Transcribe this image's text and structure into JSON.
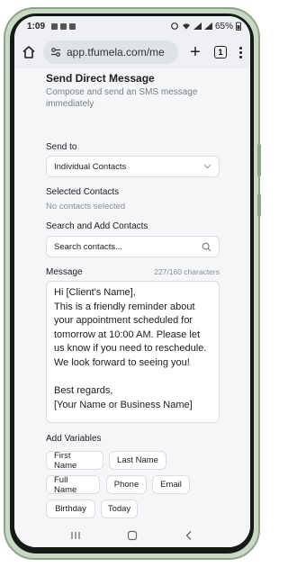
{
  "status_bar": {
    "time": "1:09",
    "battery": "65%"
  },
  "browser": {
    "url": "app.tfumela.com/me",
    "tab_count": "1"
  },
  "form": {
    "title": "Send Direct Message",
    "subtitle": "Compose and send an SMS message immediately",
    "send_to_label": "Send to",
    "send_to_value": "Individual Contacts",
    "selected_contacts_label": "Selected Contacts",
    "selected_contacts_empty": "No contacts selected",
    "search_label": "Search and Add Contacts",
    "search_placeholder": "Search contacts...",
    "message_label": "Message",
    "char_count": "227/160 characters",
    "message_text": "Hi [Client's Name],\nThis is a friendly reminder about your appointment scheduled for tomorrow at 10:00 AM. Please let us know if you need to reschedule. We look forward to seeing you!\n\nBest regards,\n[Your Name or Business Name]",
    "variables_label": "Add Variables",
    "variables": [
      "First Name",
      "Last Name",
      "Full Name",
      "Phone",
      "Email",
      "Birthday",
      "Today"
    ]
  },
  "icons": [
    "home-icon",
    "tune-icon",
    "plus-icon",
    "tabs-icon",
    "more-icon",
    "chevron-down-icon",
    "search-icon",
    "recents-icon",
    "home-nav-icon",
    "back-icon"
  ]
}
